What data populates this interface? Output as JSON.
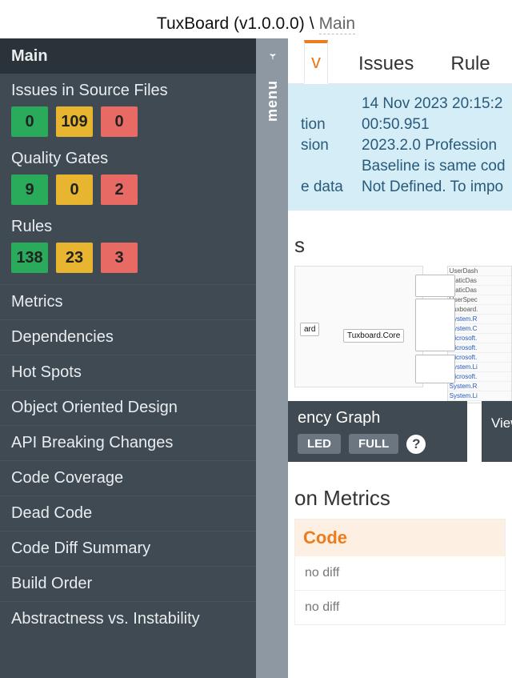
{
  "titlebar": {
    "app": "TuxBoard (v1.0.0.0)",
    "sep": "\\",
    "page": "Main"
  },
  "sidebar": {
    "header": "Main",
    "groups": [
      {
        "title": "Issues in Source Files",
        "green": "0",
        "yellow": "109",
        "red": "0"
      },
      {
        "title": "Quality Gates",
        "green": "9",
        "yellow": "0",
        "red": "2"
      },
      {
        "title": "Rules",
        "green": "138",
        "yellow": "23",
        "red": "3"
      }
    ],
    "nav": [
      "Metrics",
      "Dependencies",
      "Hot Spots",
      "Object Oriented Design",
      "API Breaking Changes",
      "Code Coverage",
      "Dead Code",
      "Code Diff Summary",
      "Build Order",
      "Abstractness vs. Instability"
    ]
  },
  "gutter": {
    "label": "menu"
  },
  "tabs": {
    "active": "v",
    "items": [
      "Issues",
      "Rule"
    ]
  },
  "info": {
    "rows": [
      {
        "label": "",
        "value": "14 Nov 2023 20:15:2"
      },
      {
        "label": "tion",
        "value": "00:50.951"
      },
      {
        "label": "sion",
        "value": "2023.2.0   Profession"
      },
      {
        "label": "",
        "value": "Baseline is same cod"
      },
      {
        "label": "e data",
        "value": "Not Defined. To impo"
      }
    ]
  },
  "sections": {
    "first": "s",
    "metrics": "on Metrics"
  },
  "graph": {
    "core_node": "Tuxboard.Core",
    "left_node": "ard"
  },
  "legend": [
    "UserDash",
    "StaticDas",
    "StaticDas",
    "UserSpec",
    "Tuxboard.",
    "System.R",
    "System.C",
    "Microsoft.",
    "Microsoft.",
    "Microsoft.",
    "System.Li",
    "Microsoft.",
    "System.R",
    "System.Li"
  ],
  "caps": {
    "graph": {
      "title": "ency Graph",
      "b1": "LED",
      "b2": "FULL"
    },
    "list": {
      "title": "",
      "action": "View a"
    }
  },
  "codebox": {
    "head": "Code",
    "body1": "no diff",
    "body2": "no diff"
  }
}
